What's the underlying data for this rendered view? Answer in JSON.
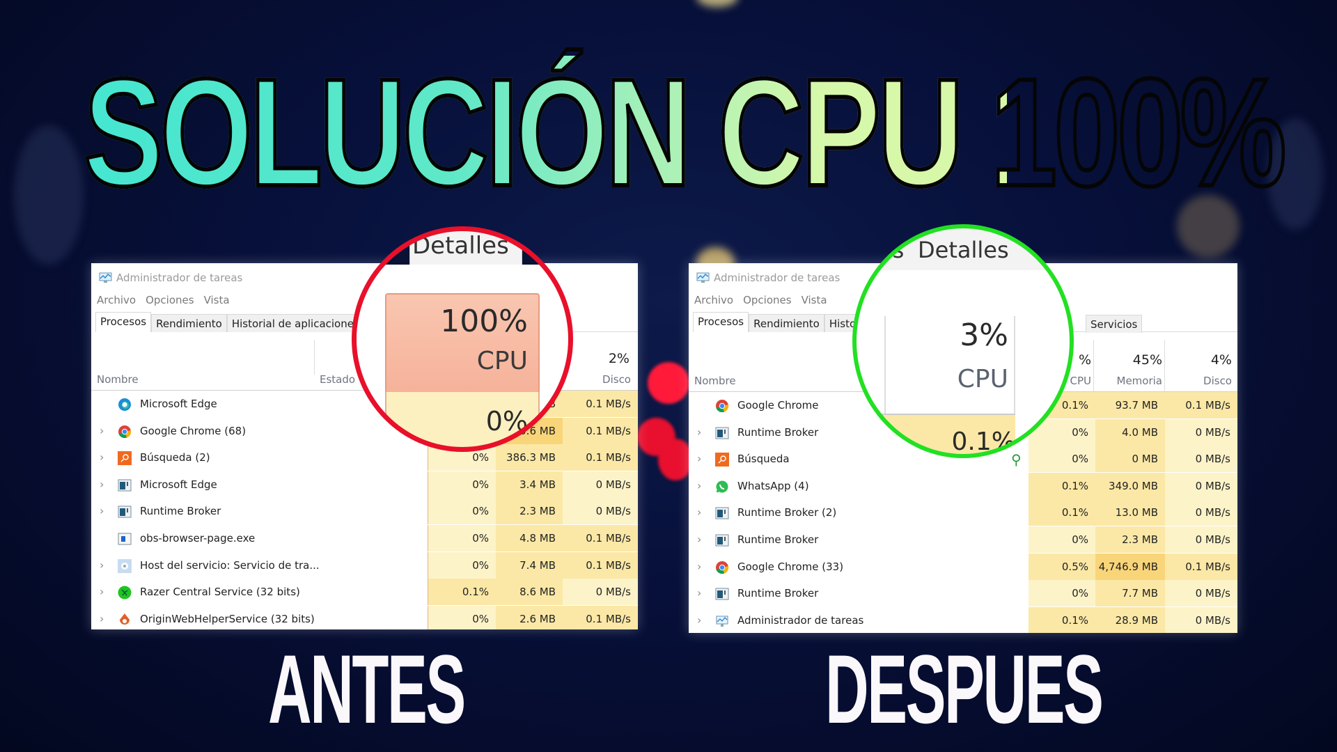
{
  "headline": "SOLUCIÓN CPU 100%",
  "colors": {
    "headline_gradient_start": "#45e6d0",
    "headline_gradient_end": "#d8f8a8",
    "caption": "#fbf8fb",
    "before_circle": "#e8102a",
    "after_circle": "#22e022",
    "cpu_high_header": "#f8c0a8",
    "cell_light": "#fdf3c8",
    "cell_medium": "#fbe8a6",
    "cell_strong": "#f9d57a",
    "background": "#07103a"
  },
  "before": {
    "caption": "ANTES",
    "window_title": "Administrador de tareas",
    "menu": [
      "Archivo",
      "Opciones",
      "Vista"
    ],
    "tabs": [
      "Procesos",
      "Rendimiento",
      "Historial de aplicaciones"
    ],
    "magnified_tab": "Detalles",
    "columns": {
      "name": "Nombre",
      "status": "Estado",
      "cpu": {
        "percent": "100%",
        "label": "CPU"
      },
      "disk": {
        "percent": "2%",
        "label": "Disco"
      }
    },
    "magnified_cpu_value": "0%",
    "rows": [
      {
        "name": "Microsoft Edge",
        "icon": "edge-icon",
        "expandable": false,
        "cpu": "0%",
        "memory": "…B",
        "disk": "0.1 MB/s"
      },
      {
        "name": "Google Chrome (68)",
        "icon": "chrome-icon",
        "expandable": true,
        "cpu": "",
        "memory": "…0.6 MB",
        "disk": "0.1 MB/s"
      },
      {
        "name": "Búsqueda (2)",
        "icon": "search-app-icon",
        "expandable": true,
        "cpu": "0%",
        "memory": "386.3 MB",
        "disk": "0.1 MB/s"
      },
      {
        "name": "Microsoft Edge",
        "icon": "app-window-icon",
        "expandable": true,
        "cpu": "0%",
        "memory": "3.4 MB",
        "disk": "0 MB/s"
      },
      {
        "name": "Runtime Broker",
        "icon": "app-window-icon",
        "expandable": true,
        "cpu": "0%",
        "memory": "2.3 MB",
        "disk": "0 MB/s"
      },
      {
        "name": "obs-browser-page.exe",
        "icon": "exe-window-icon",
        "expandable": false,
        "cpu": "0%",
        "memory": "4.8 MB",
        "disk": "0.1 MB/s"
      },
      {
        "name": "Host del servicio: Servicio de tra...",
        "icon": "gear-icon",
        "expandable": true,
        "cpu": "0%",
        "memory": "7.4 MB",
        "disk": "0.1 MB/s"
      },
      {
        "name": "Razer Central Service (32 bits)",
        "icon": "razer-icon",
        "expandable": true,
        "cpu": "0.1%",
        "memory": "8.6 MB",
        "disk": "0 MB/s"
      },
      {
        "name": "OriginWebHelperService (32 bits)",
        "icon": "origin-icon",
        "expandable": true,
        "cpu": "0%",
        "memory": "2.6 MB",
        "disk": "0.1 MB/s"
      }
    ]
  },
  "after": {
    "caption": "DESPUES",
    "window_title": "Administrador de tareas",
    "menu": [
      "Archivo",
      "Opciones",
      "Vista"
    ],
    "tabs": [
      "Procesos",
      "Rendimiento",
      "Histor",
      "Servicios"
    ],
    "tab_partial": "es",
    "magnified_tabs": [
      "os",
      "Detalles"
    ],
    "columns": {
      "name": "Nombre",
      "cpu": {
        "percent": "3%",
        "label": "CPU"
      },
      "cpu_partial": {
        "percent": "%",
        "label": "CPU"
      },
      "memory": {
        "percent": "45%",
        "label": "Memoria"
      },
      "disk": {
        "percent": "4%",
        "label": "Disco"
      }
    },
    "magnified_cpu_value": "0.1%",
    "rows": [
      {
        "name": "Google Chrome",
        "icon": "chrome-icon",
        "expandable": false,
        "cpu": "0.1%",
        "memory": "93.7 MB",
        "disk": "0.1 MB/s"
      },
      {
        "name": "Runtime Broker",
        "icon": "app-window-icon",
        "expandable": true,
        "cpu": "0%",
        "memory": "4.0 MB",
        "disk": "0 MB/s"
      },
      {
        "name": "Búsqueda",
        "icon": "search-app-icon",
        "expandable": true,
        "cpu": "0%",
        "memory": "0 MB",
        "disk": "0 MB/s",
        "suspended": true
      },
      {
        "name": "WhatsApp (4)",
        "icon": "whatsapp-icon",
        "expandable": true,
        "cpu": "0.1%",
        "memory": "349.0 MB",
        "disk": "0 MB/s"
      },
      {
        "name": "Runtime Broker (2)",
        "icon": "app-window-icon",
        "expandable": true,
        "cpu": "0.1%",
        "memory": "13.0 MB",
        "disk": "0 MB/s"
      },
      {
        "name": "Runtime Broker",
        "icon": "app-window-icon",
        "expandable": true,
        "cpu": "0%",
        "memory": "2.3 MB",
        "disk": "0 MB/s"
      },
      {
        "name": "Google Chrome (33)",
        "icon": "chrome-icon",
        "expandable": true,
        "cpu": "0.5%",
        "memory": "4,746.9 MB",
        "disk": "0.1 MB/s"
      },
      {
        "name": "Runtime Broker",
        "icon": "app-window-icon",
        "expandable": true,
        "cpu": "0%",
        "memory": "7.7 MB",
        "disk": "0 MB/s"
      },
      {
        "name": "Administrador de tareas",
        "icon": "task-manager-icon",
        "expandable": true,
        "cpu": "0.1%",
        "memory": "28.9 MB",
        "disk": "0 MB/s"
      }
    ]
  }
}
